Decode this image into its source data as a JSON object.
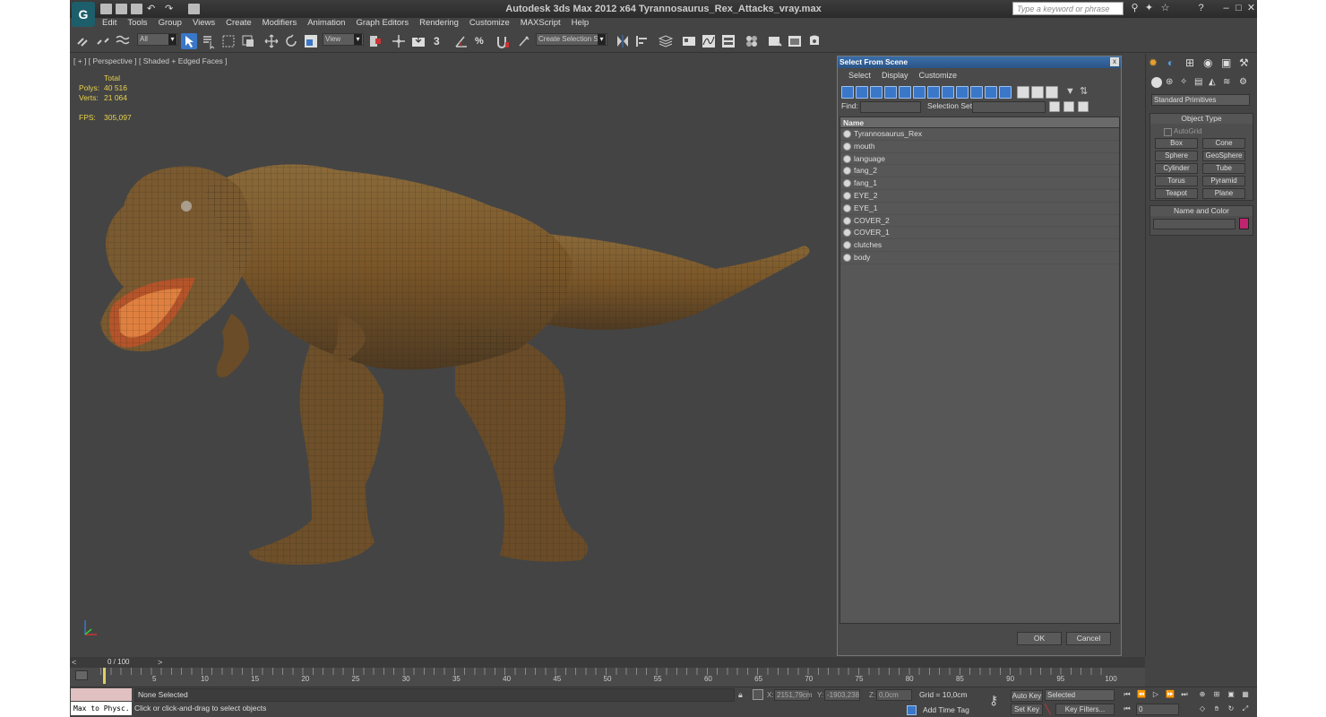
{
  "window": {
    "title": "Autodesk 3ds Max  2012 x64    Tyrannosaurus_Rex_Attacks_vray.max",
    "search_placeholder": "Type a keyword or phrase",
    "logo_letter": "G"
  },
  "menu": [
    "Edit",
    "Tools",
    "Group",
    "Views",
    "Create",
    "Modifiers",
    "Animation",
    "Graph Editors",
    "Rendering",
    "Customize",
    "MAXScript",
    "Help"
  ],
  "toolbar": {
    "selection_filter": "All",
    "ref_coord": "View",
    "named_selection": "Create Selection Se",
    "snap_label": "3",
    "angle_snap": "%"
  },
  "viewport": {
    "label": "[ + ] [ Perspective ] [ Shaded + Edged Faces ]",
    "stats_header": "Total",
    "polys_label": "Polys:",
    "polys_value": "40 516",
    "verts_label": "Verts:",
    "verts_value": "21 064",
    "fps_label": "FPS:",
    "fps_value": "305,097"
  },
  "dialog": {
    "title": "Select From Scene",
    "close": "x",
    "menu": [
      "Select",
      "Display",
      "Customize"
    ],
    "find_label": "Find:",
    "selset_label": "Selection Set:",
    "column_name": "Name",
    "objects": [
      "Tyrannosaurus_Rex",
      "mouth",
      "language",
      "fang_2",
      "fang_1",
      "EYE_2",
      "EYE_1",
      "COVER_2",
      "COVER_1",
      "clutches",
      "body"
    ],
    "ok": "OK",
    "cancel": "Cancel"
  },
  "command_panel": {
    "category": "Standard Primitives",
    "object_type_title": "Object Type",
    "autogrid": "AutoGrid",
    "buttons": [
      "Box",
      "Cone",
      "Sphere",
      "GeoSphere",
      "Cylinder",
      "Tube",
      "Torus",
      "Pyramid",
      "Teapot",
      "Plane"
    ],
    "name_color_title": "Name and Color",
    "color": "#c0246e"
  },
  "timeline": {
    "frame_display": "0 / 100",
    "ticks": [
      "5",
      "10",
      "15",
      "20",
      "25",
      "30",
      "35",
      "40",
      "45",
      "50",
      "55",
      "60",
      "65",
      "70",
      "75",
      "80",
      "85",
      "90",
      "95",
      "100"
    ]
  },
  "status": {
    "listener": "Max to Physc.",
    "selection": "None Selected",
    "prompt": "Click or click-and-drag to select objects",
    "x_label": "X:",
    "x_value": "2151,79cm",
    "y_label": "Y:",
    "y_value": "-1903,238",
    "z_label": "Z:",
    "z_value": "0,0cm",
    "grid": "Grid = 10,0cm",
    "add_time_tag": "Add Time Tag",
    "auto_key": "Auto Key",
    "set_key": "Set Key",
    "key_mode": "Selected",
    "key_filters": "Key Filters...",
    "frame": "0"
  }
}
